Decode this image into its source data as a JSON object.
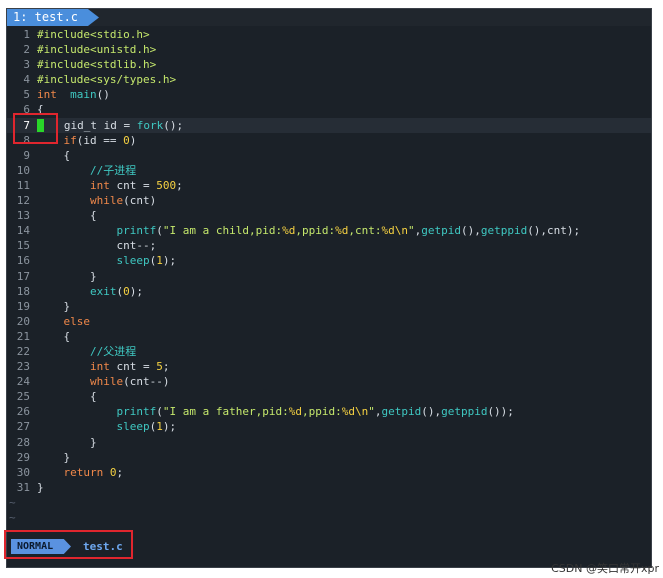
{
  "tab": {
    "label": "1: test.c"
  },
  "code_lines": [
    {
      "n": "1",
      "segs": [
        [
          "pp",
          "#include<stdio.h>"
        ]
      ]
    },
    {
      "n": "2",
      "segs": [
        [
          "pp",
          "#include<unistd.h>"
        ]
      ]
    },
    {
      "n": "3",
      "segs": [
        [
          "pp",
          "#include<stdlib.h>"
        ]
      ]
    },
    {
      "n": "4",
      "segs": [
        [
          "pp",
          "#include<sys/types.h>"
        ]
      ]
    },
    {
      "n": "5",
      "segs": [
        [
          "kw",
          "int"
        ],
        [
          "",
          "  "
        ],
        [
          "fn",
          "main"
        ],
        [
          "",
          "()"
        ]
      ]
    },
    {
      "n": "6",
      "segs": [
        [
          "",
          "{"
        ]
      ]
    },
    {
      "n": "7",
      "segs": [
        [
          "",
          "    gid_t id = "
        ],
        [
          "fn",
          "fork"
        ],
        [
          "",
          "();"
        ]
      ],
      "cursor": true
    },
    {
      "n": "8",
      "segs": [
        [
          "",
          "    "
        ],
        [
          "kw",
          "if"
        ],
        [
          "",
          "(id == "
        ],
        [
          "num",
          "0"
        ],
        [
          "",
          ")"
        ]
      ]
    },
    {
      "n": "9",
      "segs": [
        [
          "",
          "    {"
        ]
      ]
    },
    {
      "n": "10",
      "segs": [
        [
          "",
          "        "
        ],
        [
          "cm",
          "//子进程"
        ]
      ]
    },
    {
      "n": "11",
      "segs": [
        [
          "",
          "        "
        ],
        [
          "kw",
          "int"
        ],
        [
          "",
          " cnt = "
        ],
        [
          "num",
          "500"
        ],
        [
          "",
          ";"
        ]
      ]
    },
    {
      "n": "12",
      "segs": [
        [
          "",
          "        "
        ],
        [
          "kw",
          "while"
        ],
        [
          "",
          "(cnt)"
        ]
      ]
    },
    {
      "n": "13",
      "segs": [
        [
          "",
          "        {"
        ]
      ]
    },
    {
      "n": "14",
      "segs": [
        [
          "",
          "            "
        ],
        [
          "fn",
          "printf"
        ],
        [
          "",
          "("
        ],
        [
          "str",
          "\"I am a child,pid:"
        ],
        [
          "fmt",
          "%d"
        ],
        [
          "str",
          ",ppid:"
        ],
        [
          "fmt",
          "%d"
        ],
        [
          "str",
          ",cnt:"
        ],
        [
          "fmt",
          "%d\\n"
        ],
        [
          "str",
          "\""
        ],
        [
          "",
          ","
        ],
        [
          "fn",
          "getpid"
        ],
        [
          "",
          "(),"
        ],
        [
          "fn",
          "getppid"
        ],
        [
          "",
          "(),cnt);"
        ]
      ]
    },
    {
      "n": "15",
      "segs": [
        [
          "",
          "            cnt--;"
        ]
      ]
    },
    {
      "n": "16",
      "segs": [
        [
          "",
          "            "
        ],
        [
          "fn",
          "sleep"
        ],
        [
          "",
          "("
        ],
        [
          "num",
          "1"
        ],
        [
          "",
          ");"
        ]
      ]
    },
    {
      "n": "17",
      "segs": [
        [
          "",
          "        }"
        ]
      ]
    },
    {
      "n": "18",
      "segs": [
        [
          "",
          "        "
        ],
        [
          "fn",
          "exit"
        ],
        [
          "",
          "("
        ],
        [
          "num",
          "0"
        ],
        [
          "",
          ");"
        ]
      ]
    },
    {
      "n": "19",
      "segs": [
        [
          "",
          "    }"
        ]
      ]
    },
    {
      "n": "20",
      "segs": [
        [
          "",
          "    "
        ],
        [
          "kw",
          "else"
        ]
      ]
    },
    {
      "n": "21",
      "segs": [
        [
          "",
          "    {"
        ]
      ]
    },
    {
      "n": "22",
      "segs": [
        [
          "",
          "        "
        ],
        [
          "cm",
          "//父进程"
        ]
      ]
    },
    {
      "n": "23",
      "segs": [
        [
          "",
          "        "
        ],
        [
          "kw",
          "int"
        ],
        [
          "",
          " cnt = "
        ],
        [
          "num",
          "5"
        ],
        [
          "",
          ";"
        ]
      ]
    },
    {
      "n": "24",
      "segs": [
        [
          "",
          "        "
        ],
        [
          "kw",
          "while"
        ],
        [
          "",
          "(cnt--)"
        ]
      ]
    },
    {
      "n": "25",
      "segs": [
        [
          "",
          "        {"
        ]
      ]
    },
    {
      "n": "26",
      "segs": [
        [
          "",
          "            "
        ],
        [
          "fn",
          "printf"
        ],
        [
          "",
          "("
        ],
        [
          "str",
          "\"I am a father,pid:"
        ],
        [
          "fmt",
          "%d"
        ],
        [
          "str",
          ",ppid:"
        ],
        [
          "fmt",
          "%d\\n"
        ],
        [
          "str",
          "\""
        ],
        [
          "",
          ","
        ],
        [
          "fn",
          "getpid"
        ],
        [
          "",
          "(),"
        ],
        [
          "fn",
          "getppid"
        ],
        [
          "",
          "());"
        ]
      ]
    },
    {
      "n": "27",
      "segs": [
        [
          "",
          "            "
        ],
        [
          "fn",
          "sleep"
        ],
        [
          "",
          "("
        ],
        [
          "num",
          "1"
        ],
        [
          "",
          ");"
        ]
      ]
    },
    {
      "n": "28",
      "segs": [
        [
          "",
          "        }"
        ]
      ]
    },
    {
      "n": "29",
      "segs": [
        [
          "",
          "    }"
        ]
      ]
    },
    {
      "n": "30",
      "segs": [
        [
          "",
          "    "
        ],
        [
          "kw",
          "return"
        ],
        [
          "",
          " "
        ],
        [
          "num",
          "0"
        ],
        [
          "",
          ";"
        ]
      ]
    },
    {
      "n": "31",
      "segs": [
        [
          "",
          "}"
        ]
      ]
    }
  ],
  "empty_line_marker": "~",
  "empty_line_count": 2,
  "status": {
    "mode": "NORMAL",
    "filename": "test.c"
  },
  "watermark": "CSDN @笑口常开xpr",
  "colors": {
    "background": "#1b2128",
    "keyword": "#f0884a",
    "function": "#3fc8c2",
    "number": "#f5d142",
    "string": "#c5e86c",
    "cursor": "#29d629",
    "highlight_box": "#e0262e"
  }
}
